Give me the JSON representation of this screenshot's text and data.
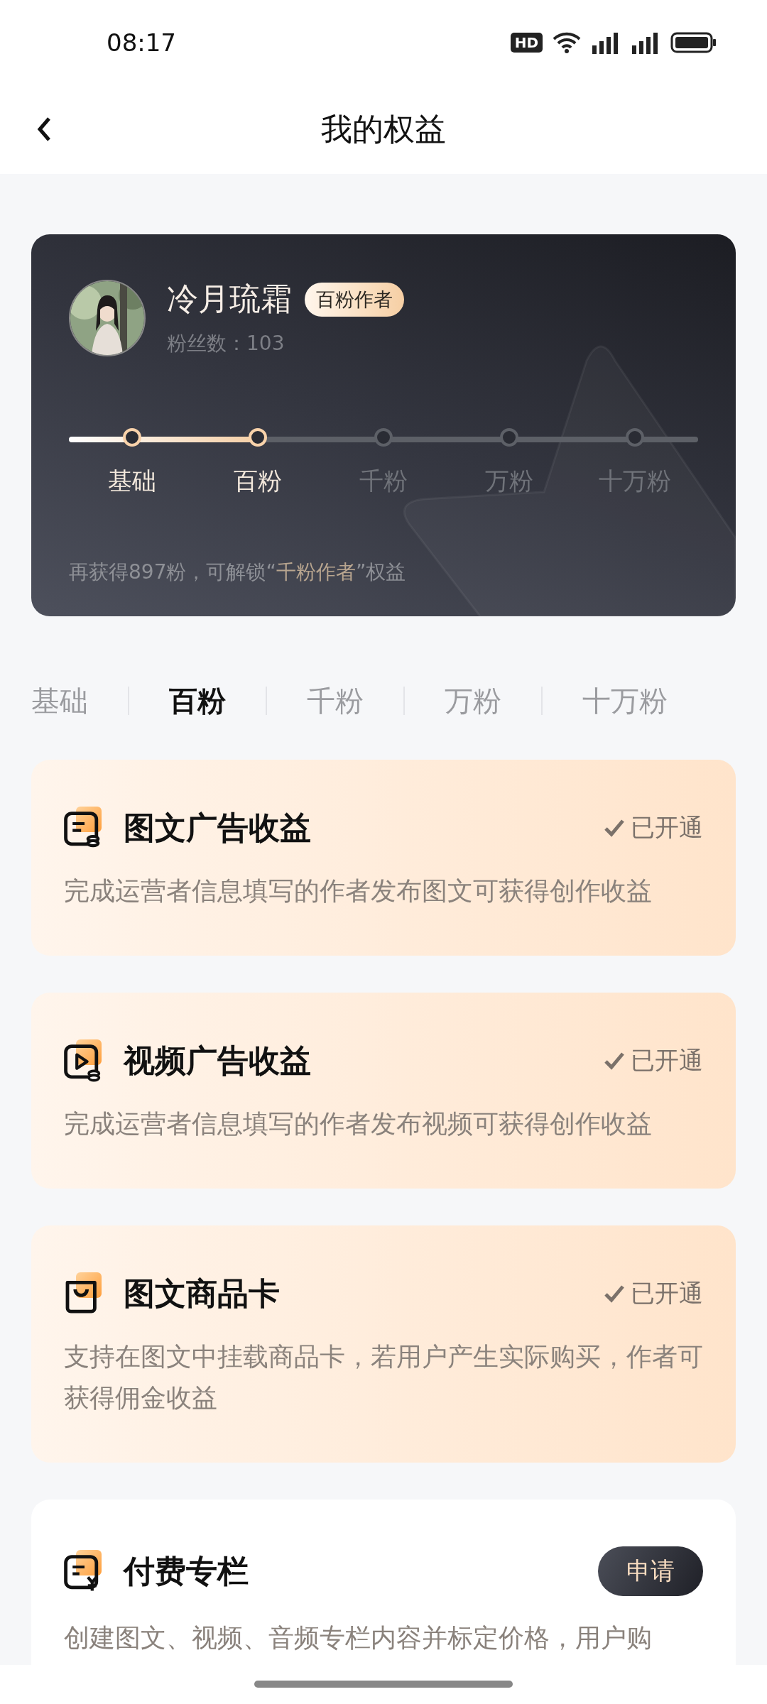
{
  "status_bar": {
    "time": "08:17",
    "hd_badge": "HD"
  },
  "header": {
    "title": "我的权益"
  },
  "profile": {
    "name": "冷月琉霜",
    "badge": "百粉作者",
    "fans_label": "粉丝数：",
    "fans": "103",
    "level": 0.3,
    "stages": [
      {
        "label": "基础",
        "reached": true
      },
      {
        "label": "百粉",
        "reached": true
      },
      {
        "label": "千粉",
        "reached": false
      },
      {
        "label": "万粉",
        "reached": false
      },
      {
        "label": "十万粉",
        "reached": false
      }
    ],
    "unlock": {
      "before": "再获得897粉，可解锁“",
      "highlight": "千粉作者",
      "after": "”权益"
    }
  },
  "tabs": [
    {
      "label": "基础",
      "selected": false
    },
    {
      "label": "百粉",
      "selected": true
    },
    {
      "label": "千粉",
      "selected": false
    },
    {
      "label": "万粉",
      "selected": false
    },
    {
      "label": "十万粉",
      "selected": false
    }
  ],
  "benefits": [
    {
      "title": "图文广告收益",
      "kind": "status",
      "status": "已开通",
      "description": "完成运营者信息填写的作者发布图文可获得创作收益"
    },
    {
      "title": "视频广告收益",
      "kind": "status",
      "status": "已开通",
      "description": "完成运营者信息填写的作者发布视频可获得创作收益"
    },
    {
      "title": "图文商品卡",
      "kind": "status",
      "status": "已开通",
      "description": "支持在图文中挂载商品卡，若用户产生实际购买，作者可获得佣金收益"
    },
    {
      "title": "付费专栏",
      "kind": "button",
      "action": "申请",
      "description": "创建图文、视频、音频专栏内容并标定价格，用户购"
    }
  ]
}
